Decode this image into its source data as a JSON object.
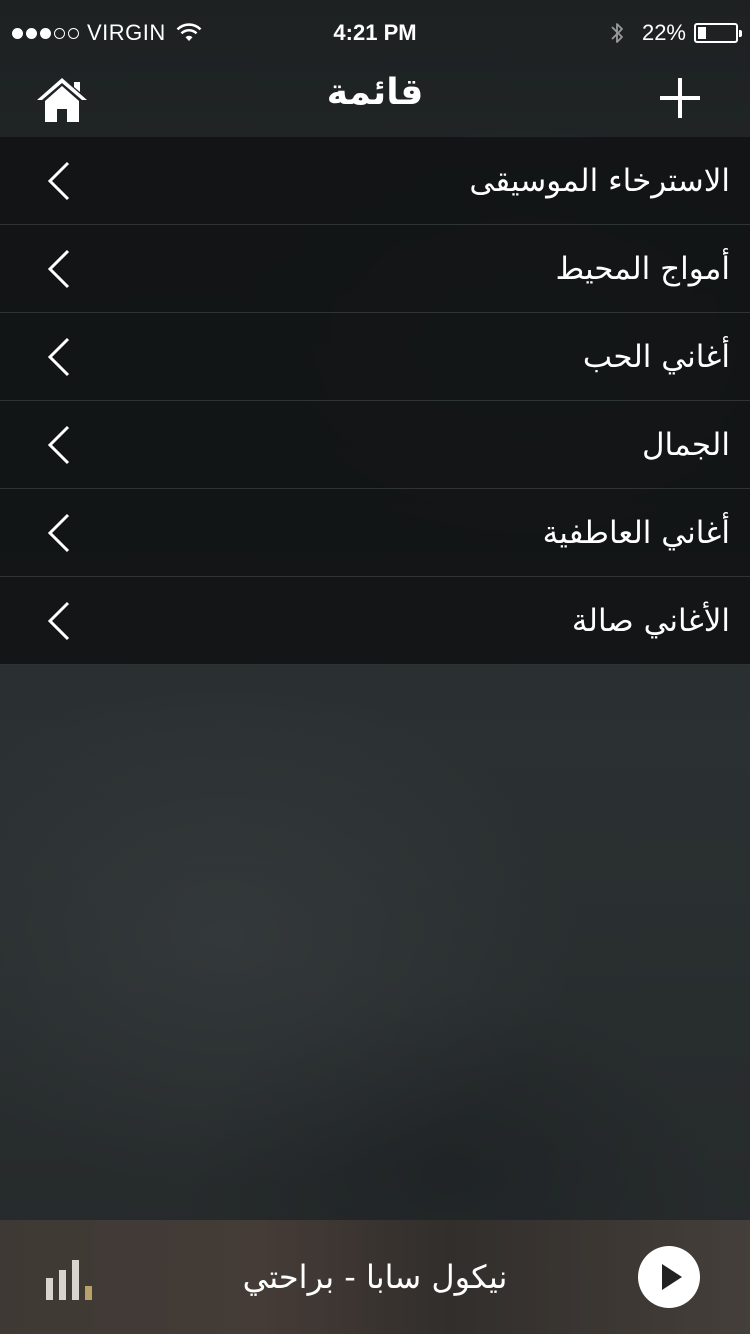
{
  "status_bar": {
    "carrier": "VIRGIN",
    "time": "4:21 PM",
    "battery_percent": "22%",
    "signal_bars_filled": 3,
    "signal_bars_total": 5,
    "battery_level": 0.22
  },
  "nav": {
    "title": "قائمة",
    "left_icon": "home-icon",
    "right_icon": "plus-icon"
  },
  "playlists": [
    {
      "label": "الاسترخاء الموسيقى"
    },
    {
      "label": "أمواج المحيط"
    },
    {
      "label": "أغاني الحب"
    },
    {
      "label": "الجمال"
    },
    {
      "label": "أغاني العاطفية"
    },
    {
      "label": "الأغاني صالة"
    }
  ],
  "player": {
    "now_playing": "نيكول سابا - براحتي",
    "left_icon": "equalizer-icon",
    "right_icon": "play-icon"
  },
  "colors": {
    "list_background": "#111314",
    "divider": "#2e3334",
    "text": "#ffffff"
  }
}
